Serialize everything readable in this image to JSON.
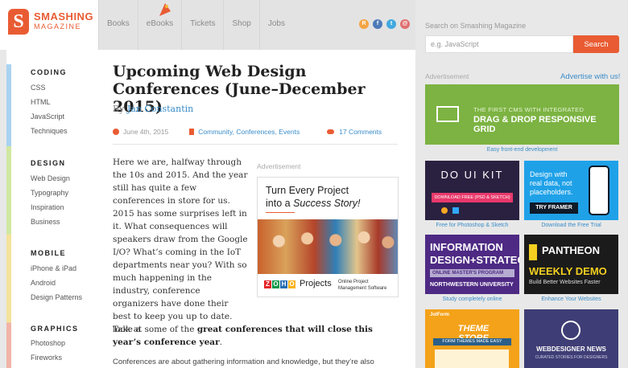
{
  "logo": {
    "letter": "S",
    "title": "SMASHING",
    "subtitle": "MAGAZINE"
  },
  "nav": {
    "items": [
      "Books",
      "eBooks",
      "Tickets",
      "Shop",
      "Jobs"
    ]
  },
  "socials": {
    "rss": "R",
    "facebook": "f",
    "twitter": "t",
    "email": "@"
  },
  "sidebar": {
    "categories": [
      {
        "title": "CODING",
        "links": [
          "CSS",
          "HTML",
          "JavaScript",
          "Techniques"
        ]
      },
      {
        "title": "DESIGN",
        "links": [
          "Web Design",
          "Typography",
          "Inspiration",
          "Business"
        ]
      },
      {
        "title": "MOBILE",
        "links": [
          "iPhone & iPad",
          "Android",
          "Design Patterns"
        ]
      },
      {
        "title": "GRAPHICS",
        "links": [
          "Photoshop",
          "Fireworks"
        ]
      }
    ]
  },
  "article": {
    "title": "Upcoming Web Design Conferences (June–December 2015)",
    "by": "By",
    "author": "Jan Constantin",
    "date": "June 4th, 2015",
    "categories": "Community, Conferences, Events",
    "comments": "17 Comments",
    "para1": "Here we are, halfway through the 10s and 2015. And the year still has quite a few conferences in store for us. 2015 has some surprises left in it. What consequences will speakers draw from the Google I/O? What’s coming in the IoT departments near you? With so much happening in the industry, conference organizers have done their best to keep you up to date. Take a",
    "para1_cont": "look at some of the",
    "para1_bold": "great conferences that will close this year’s conference year",
    "para1_end": ".",
    "para2": "Conferences are about gathering information and knowledge, but they’re also"
  },
  "inline_ad": {
    "label": "Advertisement",
    "headline1": "Turn Every Project",
    "headline2a": "into a",
    "headline2b": "Success Story!",
    "logo_letters": [
      "Z",
      "O",
      "H",
      "O"
    ],
    "product": "Projects",
    "tagline": "Online Project Management Software"
  },
  "search": {
    "label": "Search on Smashing Magazine",
    "placeholder": "e.g. JavaScript",
    "button": "Search"
  },
  "right_ads": {
    "label": "Advertisement",
    "advertise_link": "Advertise with us!",
    "banner": {
      "line1": "THE FIRST CMS WITH INTEGRATED",
      "line2": "DRAG & DROP RESPONSIVE GRID",
      "caption": "Easy front-end development"
    },
    "tiles": [
      {
        "title": "DO UI KIT",
        "button": "DOWNLOAD FREE (PSD & SKETCH)",
        "caption": "Free for Photoshop & Sketch"
      },
      {
        "title": "Design with real data, not placeholders.",
        "button": "TRY FRAMER",
        "caption": "Download the Free Trial"
      },
      {
        "title1": "INFORMATION",
        "title2": "DESIGN+STRATEGY",
        "band": "ONLINE MASTER'S PROGRAM",
        "uni": "NORTHWESTERN UNIVERSITY",
        "caption": "Study completely online"
      },
      {
        "title": "PANTHEON",
        "title2": "WEEKLY DEMO",
        "sub": "Build Better Websites Faster",
        "caption": "Enhance Your Websites"
      },
      {
        "brand": "JotForm",
        "title": "THEME STORE",
        "sub": "FORM THEMES MADE EASY"
      },
      {
        "title": "WEBDESIGNER NEWS",
        "sub": "CURATED STORIES FOR DESIGNERS"
      }
    ]
  },
  "colors": {
    "accent": "#e95c33",
    "link": "#3a8dc9",
    "green": "#7cb342"
  }
}
